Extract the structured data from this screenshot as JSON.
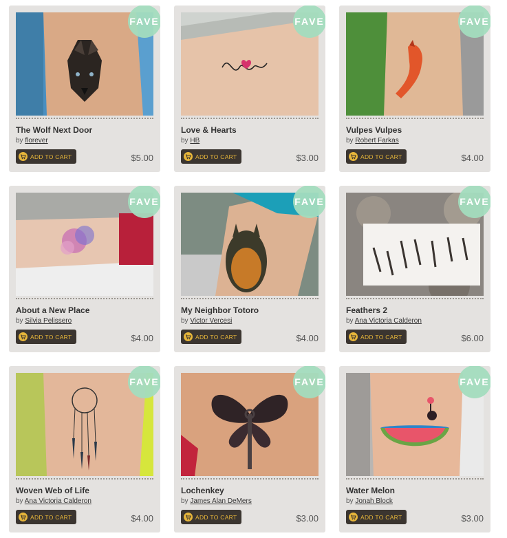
{
  "labels": {
    "fave": "FAVE",
    "add_to_cart": "ADD TO CART",
    "by": "by"
  },
  "icons": {
    "fave": "fave-badge",
    "cart": "cart-icon"
  },
  "colors": {
    "fave_badge": "#a3dcbe",
    "cart_button": "#3b3530",
    "cart_text": "#e7b63a",
    "card_bg": "#e4e2e0"
  },
  "products": [
    {
      "title": "The Wolf Next Door",
      "author": "florever",
      "price": "$5.00"
    },
    {
      "title": "Love & Hearts",
      "author": "HB",
      "price": "$3.00"
    },
    {
      "title": "Vulpes Vulpes",
      "author": "Robert Farkas",
      "price": "$4.00"
    },
    {
      "title": "About a New Place",
      "author": "Silvia Pelissero",
      "price": "$4.00"
    },
    {
      "title": "My Neighbor Totoro",
      "author": "Victor Vercesi",
      "price": "$4.00"
    },
    {
      "title": "Feathers 2",
      "author": "Ana Victoria Calderon",
      "price": "$6.00"
    },
    {
      "title": "Woven Web of Life",
      "author": "Ana Victoria Calderon",
      "price": "$4.00"
    },
    {
      "title": "Lochenkey",
      "author": "James Alan DeMers",
      "price": "$3.00"
    },
    {
      "title": "Water Melon",
      "author": "Jonah Block",
      "price": "$3.00"
    }
  ]
}
